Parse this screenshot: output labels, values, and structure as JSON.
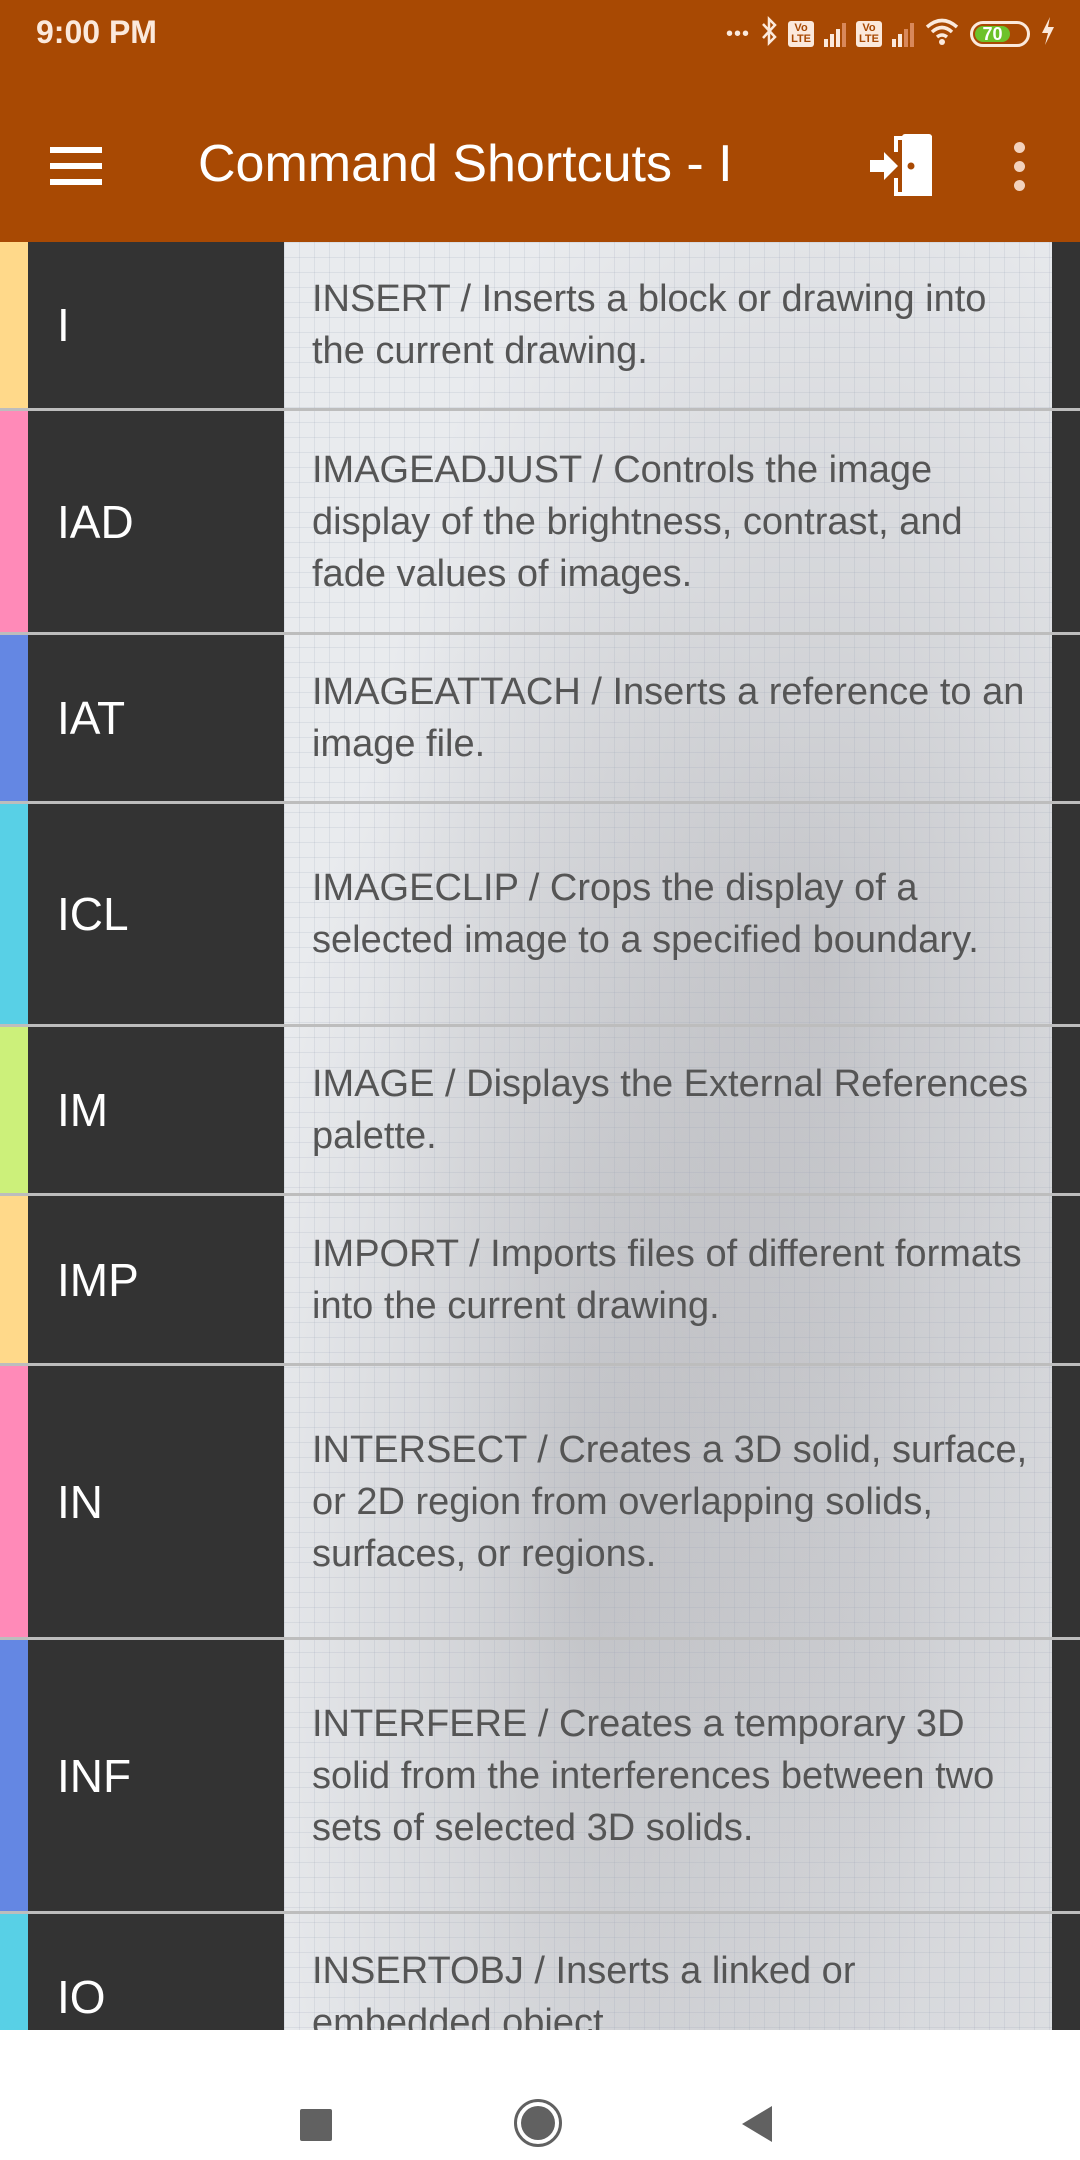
{
  "status_bar": {
    "time": "9:00 PM",
    "icons": [
      "more-dots-icon",
      "bluetooth-icon",
      "volte-icon",
      "signal-icon",
      "volte-icon",
      "signal-icon",
      "wifi-icon",
      "battery-icon",
      "charging-icon"
    ],
    "volte_label_top": "Vo",
    "volte_label_bottom": "LTE",
    "overflow_dots": "•••",
    "battery_level": "70",
    "battery_color": "#6dc22a"
  },
  "app_bar": {
    "title": "Command Shortcuts - I",
    "background": "#a84903",
    "menu_icon": "hamburger-menu-icon",
    "action_icon": "exit-door-icon",
    "overflow_icon": "more-vert-icon"
  },
  "shortcuts": [
    {
      "code": "I",
      "description": "INSERT / Inserts a block or drawing into the current drawing.",
      "color": "#ffd98a"
    },
    {
      "code": "IAD",
      "description": "IMAGEADJUST / Controls the image display of the brightness, contrast, and fade values of images.",
      "color": "#ff8ab8"
    },
    {
      "code": "IAT",
      "description": "IMAGEATTACH / Inserts a reference to an image file.",
      "color": "#6487e3"
    },
    {
      "code": "ICL",
      "description": "IMAGECLIP / Crops the display of a selected image to a specified boundary.",
      "color": "#58d0e6"
    },
    {
      "code": "IM",
      "description": "IMAGE / Displays the External References palette.",
      "color": "#ccf07a"
    },
    {
      "code": "IMP",
      "description": "IMPORT / Imports files of different formats into the current drawing.",
      "color": "#ffd98a"
    },
    {
      "code": "IN",
      "description": "INTERSECT / Creates a 3D solid, surface, or 2D region from overlapping solids, surfaces, or regions.",
      "color": "#ff8ab8"
    },
    {
      "code": "INF",
      "description": "INTERFERE / Creates a temporary 3D solid from the interferences between two sets of selected 3D solids.",
      "color": "#6487e3"
    },
    {
      "code": "IO",
      "description": "INSERTOBJ / Inserts a linked or embedded object.",
      "color": "#58d0e6"
    }
  ],
  "nav_bar": {
    "recent_icon": "recent-apps-icon",
    "home_icon": "home-icon",
    "back_icon": "back-icon"
  }
}
